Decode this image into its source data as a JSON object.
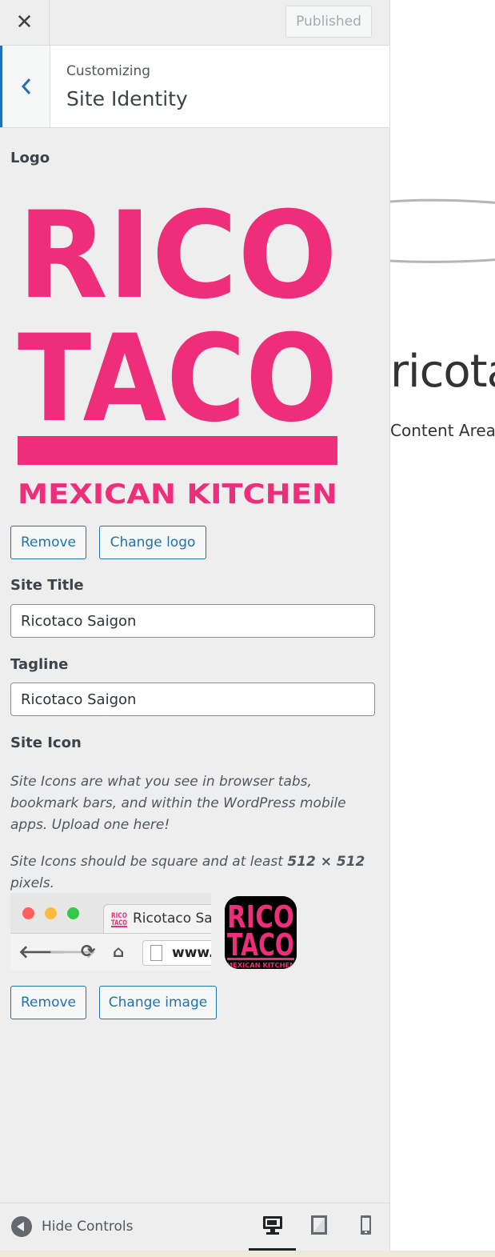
{
  "topbar": {
    "close_glyph": "✕",
    "publish_label": "Published"
  },
  "section": {
    "back_glyph": "‹",
    "customizing_label": "Customizing",
    "title": "Site Identity"
  },
  "logo": {
    "label": "Logo",
    "image_lines": [
      "RICO",
      "TACO",
      "MEXICAN KITCHEN"
    ],
    "brand_color": "#ee2d7b",
    "remove_label": "Remove",
    "change_label": "Change logo"
  },
  "site_title": {
    "label": "Site Title",
    "value": "Ricotaco Saigon"
  },
  "tagline": {
    "label": "Tagline",
    "value": "Ricotaco Saigon"
  },
  "site_icon": {
    "label": "Site Icon",
    "description": "Site Icons are what you see in browser tabs, bookmark bars, and within the WordPress mobile apps. Upload one here!",
    "size_note_prefix": "Site Icons should be square and at least ",
    "size_note_value": "512 × 512",
    "size_note_suffix": " pixels.",
    "tab_title": "Ricotaco Saigon",
    "url_text": "www.",
    "remove_label": "Remove",
    "change_label": "Change image"
  },
  "footer": {
    "hide_controls_label": "Hide Controls",
    "devices": [
      "desktop-icon",
      "tablet-icon",
      "mobile-icon"
    ],
    "active_device": "desktop"
  },
  "preview": {
    "site_title": "ricotaco",
    "content_label": "Content Area"
  }
}
